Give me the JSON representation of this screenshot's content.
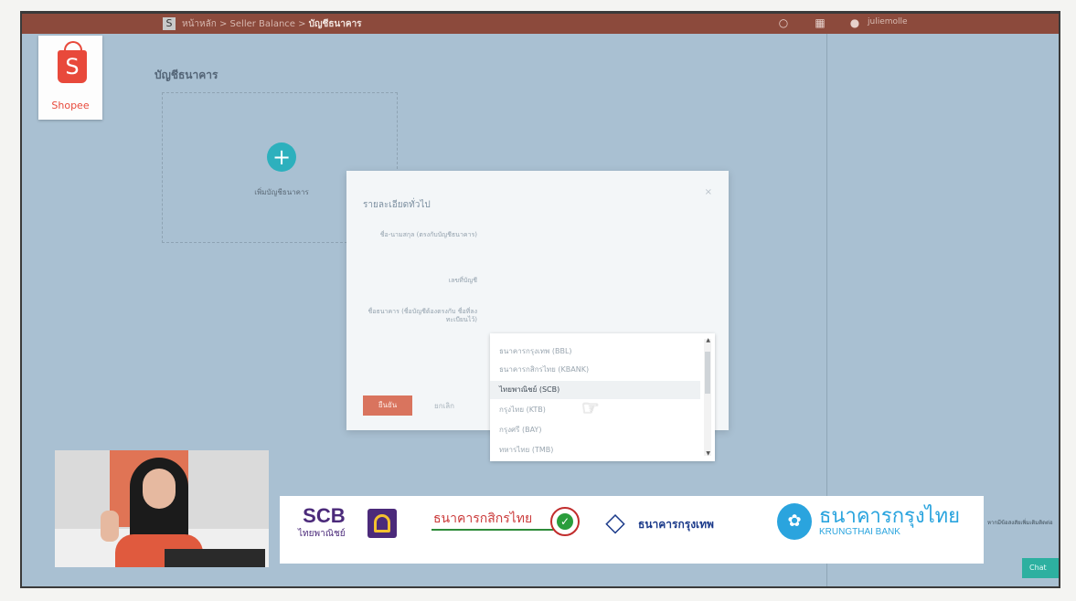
{
  "topbar": {
    "crumb_icon": "S",
    "breadcrumb_prefix": "หน้าหลัก > Seller Balance > ",
    "breadcrumb_current": "บัญชีธนาคาร",
    "bell_icon": "bell-icon",
    "apps_icon": "grid-icon",
    "user_icon": "user-icon",
    "username": "juliemolle"
  },
  "logo": {
    "mark": "S",
    "word": "Shopee"
  },
  "page": {
    "title": "บัญชีธนาคาร"
  },
  "add_card": {
    "plus": "+",
    "label": "เพิ่มบัญชีธนาคาร"
  },
  "modal": {
    "title": "รายละเอียดทั่วไป",
    "close": "×",
    "labels": [
      "ชื่อ-นามสกุล (ตรงกับบัญชีธนาคาร)",
      "เลขที่บัญชี",
      "ชื่อธนาคาร (ชื่อบัญชีต้องตรงกับ ชื่อที่ลงทะเบียนไว้)"
    ],
    "confirm_label": "ยืนยัน",
    "cancel_label": "ยกเลิก"
  },
  "bank_dropdown": {
    "options": [
      "ธนาคารกรุงเทพ (BBL)",
      "ธนาคารกสิกรไทย (KBANK)",
      "ไทยพาณิชย์ (SCB)",
      "กรุงไทย (KTB)",
      "กรุงศรี (BAY)",
      "ทหารไทย (TMB)"
    ],
    "selected_index": 2
  },
  "banner": {
    "scb_name": "SCB",
    "scb_thai": "ไทยพาณิชย์",
    "kbank_thai": "ธนาคารกสิกรไทย",
    "kbank_mark": "✓",
    "bbl_thai": "ธนาคารกรุงเทพ",
    "ktb_thai": "ธนาคารกรุงไทย",
    "ktb_en": "KRUNGTHAI BANK"
  },
  "side_note": "หากมีข้อสงสัยเพิ่มเติมติดต่อ",
  "chat_button": "Chat",
  "colors": {
    "topbar": "#8c4a3c",
    "brand": "#e8493b",
    "accent": "#2db0bd",
    "confirm": "#d9745e"
  }
}
